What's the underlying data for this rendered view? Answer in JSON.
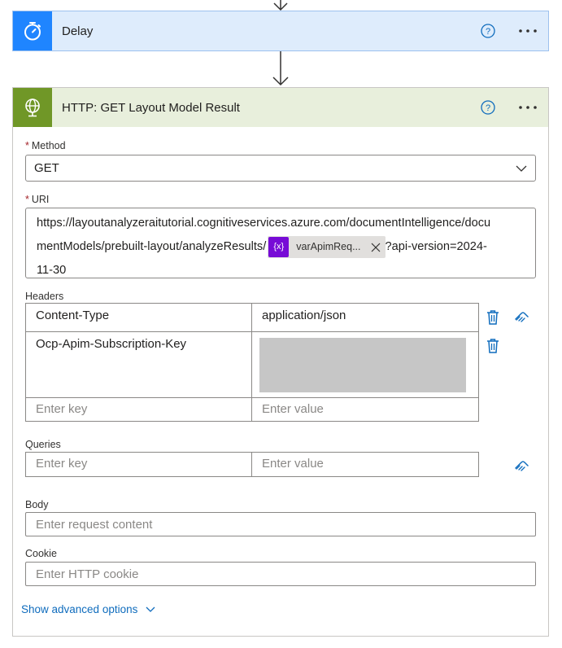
{
  "delay_card": {
    "title": "Delay",
    "icon": "stopwatch-icon"
  },
  "http_card": {
    "title": "HTTP: GET Layout Model Result",
    "icon": "globe-icon",
    "method": {
      "label": "Method",
      "value": "GET"
    },
    "uri": {
      "label": "URI",
      "line1": "https://layoutanalyzeraitutorial.cognitiveservices.azure.com/documentIntelligence/docu",
      "line2_prefix": "mentModels/prebuilt-layout/analyzeResults/",
      "token_symbol": "{x}",
      "token_label": "varApimReq...",
      "line2_suffix": "?api-version=2024-",
      "line3": "11-30"
    },
    "headers": {
      "label": "Headers",
      "rows": [
        {
          "key": "Content-Type",
          "value": "application/json"
        },
        {
          "key": "Ocp-Apim-Subscription-Key",
          "value": ""
        }
      ],
      "key_placeholder": "Enter key",
      "value_placeholder": "Enter value"
    },
    "queries": {
      "label": "Queries",
      "key_placeholder": "Enter key",
      "value_placeholder": "Enter value"
    },
    "body": {
      "label": "Body",
      "placeholder": "Enter request content"
    },
    "cookie": {
      "label": "Cookie",
      "placeholder": "Enter HTTP cookie"
    },
    "advanced_options": "Show advanced options"
  },
  "colors": {
    "delay_accent": "#1f85ff",
    "delay_header_bg": "#deecfc",
    "http_accent": "#709727",
    "http_header_bg": "#e8efdc",
    "token_purple": "#770bd6",
    "link_blue": "#0f6cbd"
  }
}
